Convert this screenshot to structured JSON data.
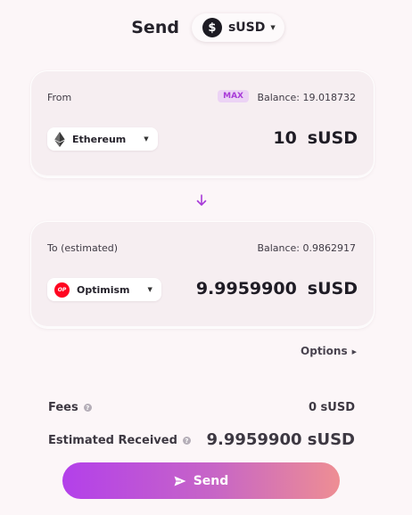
{
  "header": {
    "title": "Send",
    "token": {
      "symbol": "sUSD",
      "icon": "dollar-icon",
      "icon_glyph": "$",
      "icon_color": "#1c1a22"
    }
  },
  "from": {
    "label": "From",
    "max_label": "MAX",
    "balance_text": "Balance: 19.018732",
    "chain": {
      "name": "Ethereum",
      "icon": "ethereum-icon"
    },
    "amount": "10",
    "unit": "sUSD"
  },
  "swap": {
    "icon": "arrow-down-icon",
    "color": "#a83ad8"
  },
  "to": {
    "label": "To (estimated)",
    "balance_text": "Balance: 0.9862917",
    "chain": {
      "name": "Optimism",
      "icon": "optimism-icon",
      "icon_text": "OP",
      "icon_color": "#ff0420"
    },
    "amount": "9.9959900",
    "unit": "sUSD"
  },
  "options": {
    "label": "Options"
  },
  "fees": {
    "label": "Fees",
    "value": "0 sUSD"
  },
  "estimated": {
    "label": "Estimated Received",
    "value": "9.9959900 sUSD"
  },
  "send_button": {
    "label": "Send",
    "icon": "paper-plane-icon"
  },
  "colors": {
    "accent": "#b340ea",
    "gradient_end": "#ee8e93",
    "background": "#fcf6f8",
    "card": "#f6eef1"
  }
}
